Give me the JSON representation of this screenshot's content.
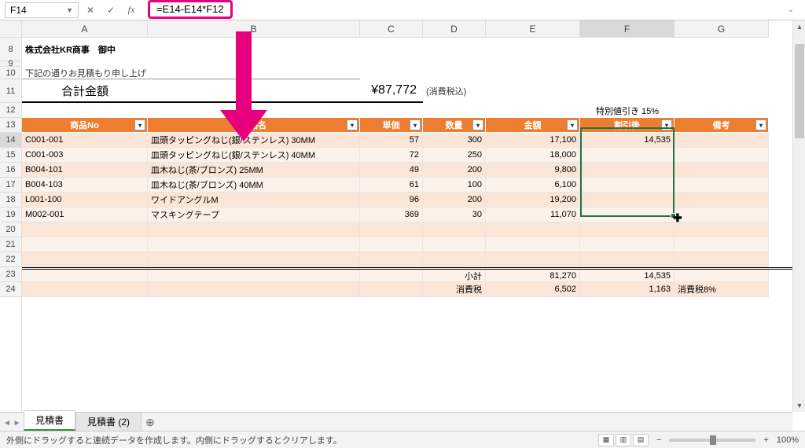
{
  "formula_bar": {
    "cell_ref": "F14",
    "formula": "=E14-E14*F12"
  },
  "columns": [
    "A",
    "B",
    "C",
    "D",
    "E",
    "F",
    "G"
  ],
  "row_numbers_pre": [
    "8",
    "9",
    "10"
  ],
  "row_numbers_main": [
    "11",
    "12",
    "13",
    "14",
    "15",
    "16",
    "17",
    "18",
    "19",
    "20",
    "21",
    "22",
    "23",
    "24"
  ],
  "doc": {
    "company": "株式会社KR商事　御中",
    "note": "下記の通りお見積もり申し上げます。",
    "total_label": "合計金額",
    "total_amount": "¥87,772",
    "tax_note": "(消費税込)",
    "discount_label": "特別値引き 15%"
  },
  "headers": {
    "no": "商品No",
    "name": "商品名",
    "unit": "単価",
    "qty": "数量",
    "amount": "金額",
    "discounted": "割引後",
    "remarks": "備考"
  },
  "rows": [
    {
      "no": "C001-001",
      "name": "皿頭タッピングねじ(銀/ステンレス) 30MM",
      "unit": "57",
      "qty": "300",
      "amount": "17,100",
      "disc": "14,535"
    },
    {
      "no": "C001-003",
      "name": "皿頭タッピングねじ(銀/ステンレス) 40MM",
      "unit": "72",
      "qty": "250",
      "amount": "18,000",
      "disc": ""
    },
    {
      "no": "B004-101",
      "name": "皿木ねじ(茶/ブロンズ) 25MM",
      "unit": "49",
      "qty": "200",
      "amount": "9,800",
      "disc": ""
    },
    {
      "no": "B004-103",
      "name": "皿木ねじ(茶/ブロンズ) 40MM",
      "unit": "61",
      "qty": "100",
      "amount": "6,100",
      "disc": ""
    },
    {
      "no": "L001-100",
      "name": "ワイドアングルM",
      "unit": "96",
      "qty": "200",
      "amount": "19,200",
      "disc": ""
    },
    {
      "no": "M002-001",
      "name": "マスキングテープ",
      "unit": "369",
      "qty": "30",
      "amount": "11,070",
      "disc": ""
    }
  ],
  "subtotal": {
    "label": "小計",
    "amount": "81,270",
    "disc": "14,535"
  },
  "tax": {
    "label": "消費税",
    "amount": "6,502",
    "disc": "1,163",
    "note": "消費税8%"
  },
  "tabs": {
    "active": "見積書",
    "others": [
      "見積書 (2)"
    ]
  },
  "status": {
    "msg": "外側にドラッグすると連続データを作成します。内側にドラッグするとクリアします。",
    "zoom": "100%"
  }
}
